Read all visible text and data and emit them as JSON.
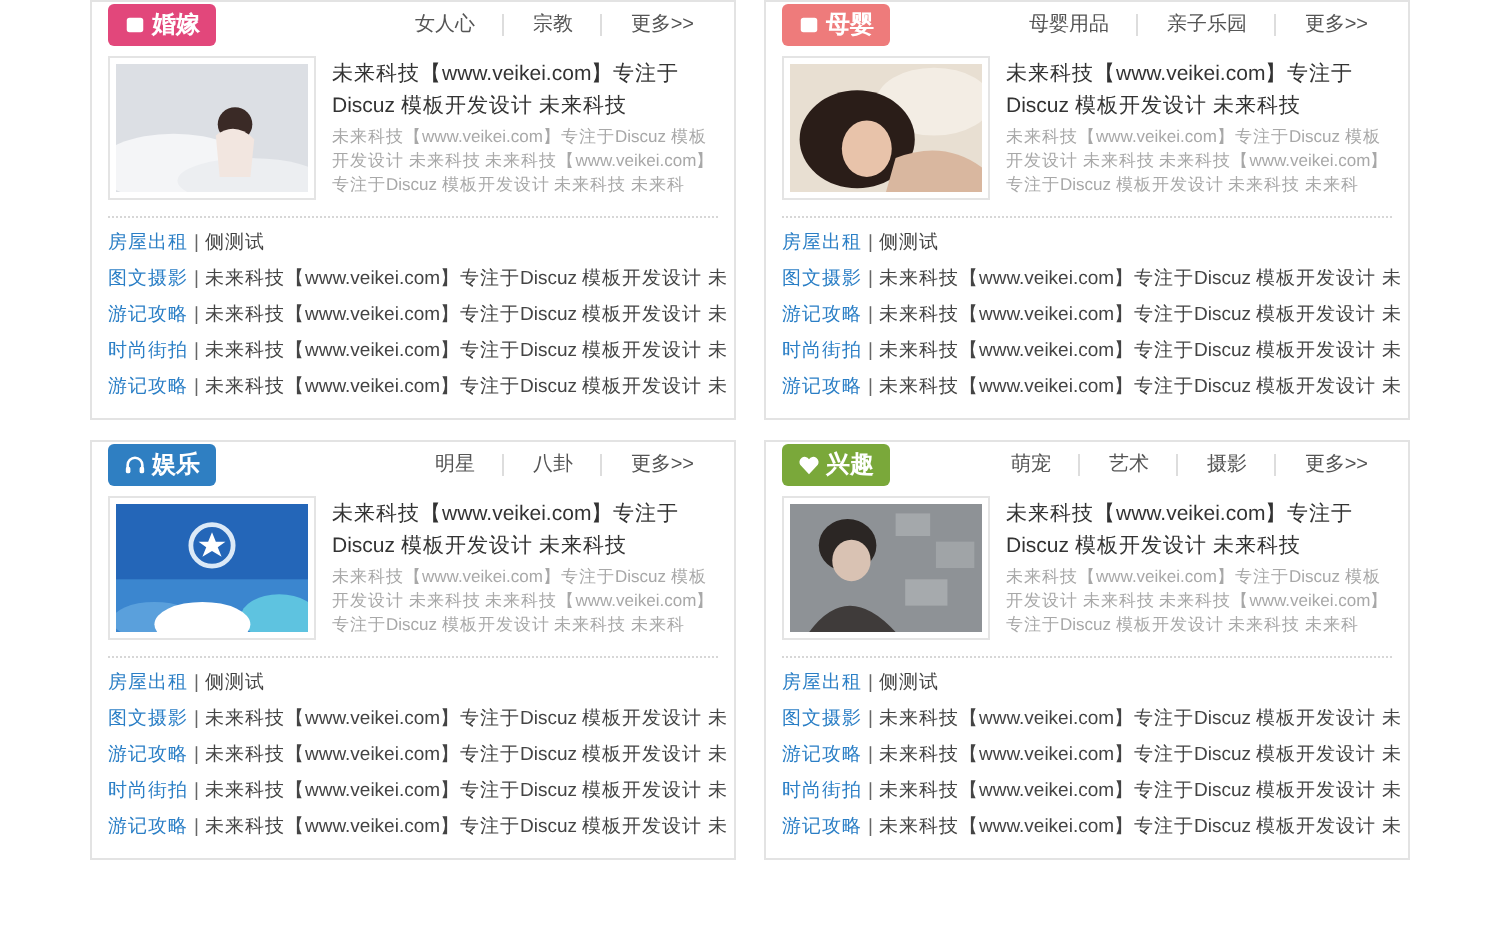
{
  "panels": [
    {
      "badge": {
        "label": "婚嫁",
        "color": "#e2477b"
      },
      "tags": [
        "女人心",
        "宗教",
        "更多>>"
      ],
      "feature": {
        "title": "未来科技【www.veikei.com】专注于Discuz 模板开发设计 未来科技",
        "description": "未来科技【www.veikei.com】专注于Discuz 模板开发设计 未来科技 未来科技【www.veikei.com】专注于Discuz 模板开发设计 未来科技 未来科"
      },
      "rows": [
        {
          "category": "房屋出租",
          "separator": "|",
          "text": "侧测试"
        },
        {
          "category": "图文摄影",
          "separator": "|",
          "text": "未来科技【www.veikei.com】专注于Discuz 模板开发设计 未"
        },
        {
          "category": "游记攻略",
          "separator": "|",
          "text": "未来科技【www.veikei.com】专注于Discuz 模板开发设计 未"
        },
        {
          "category": "时尚街拍",
          "separator": "|",
          "text": "未来科技【www.veikei.com】专注于Discuz 模板开发设计 未"
        },
        {
          "category": "游记攻略",
          "separator": "|",
          "text": "未来科技【www.veikei.com】专注于Discuz 模板开发设计 未"
        }
      ]
    },
    {
      "badge": {
        "label": "母婴",
        "color": "#ee7b7b"
      },
      "tags": [
        "母婴用品",
        "亲子乐园",
        "更多>>"
      ],
      "feature": {
        "title": "未来科技【www.veikei.com】专注于Discuz 模板开发设计 未来科技",
        "description": "未来科技【www.veikei.com】专注于Discuz 模板开发设计 未来科技 未来科技【www.veikei.com】专注于Discuz 模板开发设计 未来科技 未来科"
      },
      "rows": [
        {
          "category": "房屋出租",
          "separator": "|",
          "text": "侧测试"
        },
        {
          "category": "图文摄影",
          "separator": "|",
          "text": "未来科技【www.veikei.com】专注于Discuz 模板开发设计 未"
        },
        {
          "category": "游记攻略",
          "separator": "|",
          "text": "未来科技【www.veikei.com】专注于Discuz 模板开发设计 未"
        },
        {
          "category": "时尚街拍",
          "separator": "|",
          "text": "未来科技【www.veikei.com】专注于Discuz 模板开发设计 未"
        },
        {
          "category": "游记攻略",
          "separator": "|",
          "text": "未来科技【www.veikei.com】专注于Discuz 模板开发设计 未"
        }
      ]
    },
    {
      "badge": {
        "label": "娱乐",
        "color": "#2f7fc2"
      },
      "tags": [
        "明星",
        "八卦",
        "更多>>"
      ],
      "feature": {
        "title": "未来科技【www.veikei.com】专注于Discuz 模板开发设计 未来科技",
        "description": "未来科技【www.veikei.com】专注于Discuz 模板开发设计 未来科技 未来科技【www.veikei.com】专注于Discuz 模板开发设计 未来科技 未来科"
      },
      "rows": [
        {
          "category": "房屋出租",
          "separator": "|",
          "text": "侧测试"
        },
        {
          "category": "图文摄影",
          "separator": "|",
          "text": "未来科技【www.veikei.com】专注于Discuz 模板开发设计 未"
        },
        {
          "category": "游记攻略",
          "separator": "|",
          "text": "未来科技【www.veikei.com】专注于Discuz 模板开发设计 未"
        },
        {
          "category": "时尚街拍",
          "separator": "|",
          "text": "未来科技【www.veikei.com】专注于Discuz 模板开发设计 未"
        },
        {
          "category": "游记攻略",
          "separator": "|",
          "text": "未来科技【www.veikei.com】专注于Discuz 模板开发设计 未"
        }
      ]
    },
    {
      "badge": {
        "label": "兴趣",
        "color": "#7aa83a"
      },
      "tags": [
        "萌宠",
        "艺术",
        "摄影",
        "更多>>"
      ],
      "feature": {
        "title": "未来科技【www.veikei.com】专注于Discuz 模板开发设计 未来科技",
        "description": "未来科技【www.veikei.com】专注于Discuz 模板开发设计 未来科技 未来科技【www.veikei.com】专注于Discuz 模板开发设计 未来科技 未来科"
      },
      "rows": [
        {
          "category": "房屋出租",
          "separator": "|",
          "text": "侧测试"
        },
        {
          "category": "图文摄影",
          "separator": "|",
          "text": "未来科技【www.veikei.com】专注于Discuz 模板开发设计 未"
        },
        {
          "category": "游记攻略",
          "separator": "|",
          "text": "未来科技【www.veikei.com】专注于Discuz 模板开发设计 未"
        },
        {
          "category": "时尚街拍",
          "separator": "|",
          "text": "未来科技【www.veikei.com】专注于Discuz 模板开发设计 未"
        },
        {
          "category": "游记攻略",
          "separator": "|",
          "text": "未来科技【www.veikei.com】专注于Discuz 模板开发设计 未"
        }
      ]
    }
  ]
}
